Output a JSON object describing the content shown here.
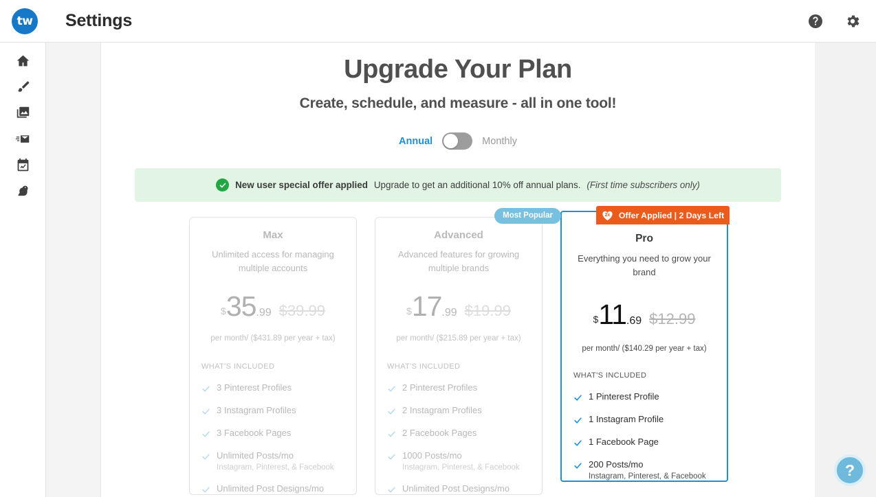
{
  "app": {
    "logo_text": "tw",
    "title": "Settings"
  },
  "topbar": {
    "help_icon": "help-circle-icon",
    "settings_icon": "gear-icon"
  },
  "sidebar": {
    "items": [
      {
        "icon": "home-icon",
        "label": "Home"
      },
      {
        "icon": "paintbrush-icon",
        "label": "Create"
      },
      {
        "icon": "image-icon",
        "label": "Media"
      },
      {
        "icon": "send-mail-icon",
        "label": "Publish"
      },
      {
        "icon": "calendar-analytics-icon",
        "label": "Calendar"
      },
      {
        "icon": "bird-icon",
        "label": "Social"
      }
    ]
  },
  "main": {
    "heading": "Upgrade Your Plan",
    "subheading": "Create, schedule, and measure - all in one tool!",
    "billing": {
      "annual_label": "Annual",
      "monthly_label": "Monthly",
      "selected": "Annual"
    },
    "promo": {
      "icon": "check-circle-icon",
      "bold_text": "New user special offer applied",
      "text": "Upgrade to get an additional 10% off annual plans.",
      "italic_text": "(First time subscribers only)"
    },
    "included_label": "WHAT'S INCLUDED",
    "plans": [
      {
        "name": "Max",
        "description": "Unlimited access for managing multiple accounts",
        "currency": "$",
        "price_whole": "35",
        "price_cents": ".99",
        "old_price": "$39.99",
        "per_text": "per month/ ($431.89 per year + tax)",
        "features": [
          {
            "label": "3 Pinterest Profiles"
          },
          {
            "label": "3 Instagram Profiles"
          },
          {
            "label": "3 Facebook Pages"
          },
          {
            "label": "Unlimited Posts/mo",
            "sub": "Instagram, Pinterest, & Facebook"
          },
          {
            "label": "Unlimited Post Designs/mo"
          }
        ]
      },
      {
        "name": "Advanced",
        "description": "Advanced features for growing multiple brands",
        "currency": "$",
        "price_whole": "17",
        "price_cents": ".99",
        "old_price": "$19.99",
        "per_text": "per month/ ($215.89 per year + tax)",
        "badge": "Most Popular",
        "features": [
          {
            "label": "2 Pinterest Profiles"
          },
          {
            "label": "2 Instagram Profiles"
          },
          {
            "label": "2 Facebook Pages"
          },
          {
            "label": "1000 Posts/mo",
            "sub": "Instagram, Pinterest, & Facebook"
          },
          {
            "label": "Unlimited Post Designs/mo"
          }
        ]
      },
      {
        "name": "Pro",
        "description": "Everything you need to grow your brand",
        "currency": "$",
        "price_whole": "11",
        "price_cents": ".69",
        "old_price": "$12.99",
        "per_text": "per month/ ($140.29 per year + tax)",
        "offer_badge": "Offer Applied | 2 Days Left",
        "offer_badge_icon_text": "2x",
        "features": [
          {
            "label": "1 Pinterest Profile"
          },
          {
            "label": "1 Instagram Profile"
          },
          {
            "label": "1 Facebook Page"
          },
          {
            "label": "200 Posts/mo",
            "sub": "Instagram, Pinterest, & Facebook"
          }
        ]
      }
    ]
  },
  "help_fab": {
    "glyph": "?"
  },
  "colors": {
    "brand_blue": "#1f8fd4",
    "offer_orange": "#ea5b1c",
    "popular_blue": "#77c0e0",
    "promo_green_bg": "#e2f4e4",
    "promo_check_green": "#22a745"
  }
}
